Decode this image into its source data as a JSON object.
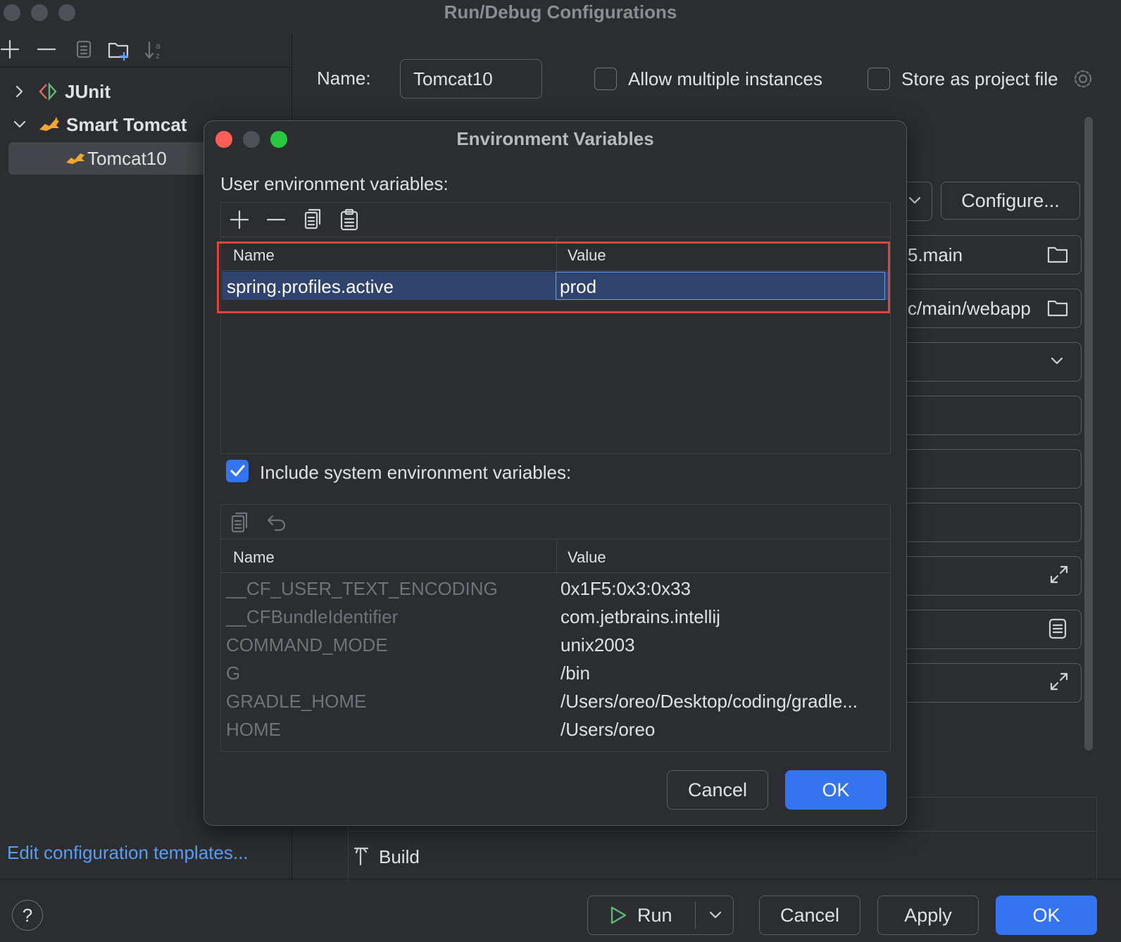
{
  "window": {
    "title": "Run/Debug Configurations"
  },
  "tree": {
    "items": [
      {
        "label": "JUnit"
      },
      {
        "label": "Smart Tomcat"
      },
      {
        "label": "Tomcat10"
      }
    ],
    "templates_link": "Edit configuration templates..."
  },
  "config": {
    "name_label": "Name:",
    "name_value": "Tomcat10",
    "allow_multiple": "Allow multiple instances",
    "store_project": "Store as project file",
    "configure_button": "Configure...",
    "path_main": "5.main",
    "path_webapp": "c/main/webapp",
    "build_label": "Build"
  },
  "footer": {
    "run": "Run",
    "cancel": "Cancel",
    "apply": "Apply",
    "ok": "OK",
    "help": "?"
  },
  "dialog": {
    "title": "Environment Variables",
    "user_section": "User environment variables:",
    "col_name": "Name",
    "col_value": "Value",
    "user_vars": [
      {
        "name": "spring.profiles.active",
        "value": "prod"
      }
    ],
    "include_system": "Include system environment variables:",
    "include_system_checked": true,
    "system_vars": [
      {
        "name": "__CF_USER_TEXT_ENCODING",
        "value": "0x1F5:0x3:0x33"
      },
      {
        "name": "__CFBundleIdentifier",
        "value": "com.jetbrains.intellij"
      },
      {
        "name": "COMMAND_MODE",
        "value": "unix2003"
      },
      {
        "name": "G",
        "value": "/bin"
      },
      {
        "name": "GRADLE_HOME",
        "value": "/Users/oreo/Desktop/coding/gradle..."
      },
      {
        "name": "HOME",
        "value": "/Users/oreo"
      }
    ],
    "cancel": "Cancel",
    "ok": "OK"
  },
  "colors": {
    "accent": "#3574f0",
    "highlight_box": "#e0443a",
    "selection": "#2e436e",
    "close": "#ff5f57",
    "zoom": "#28c840"
  }
}
